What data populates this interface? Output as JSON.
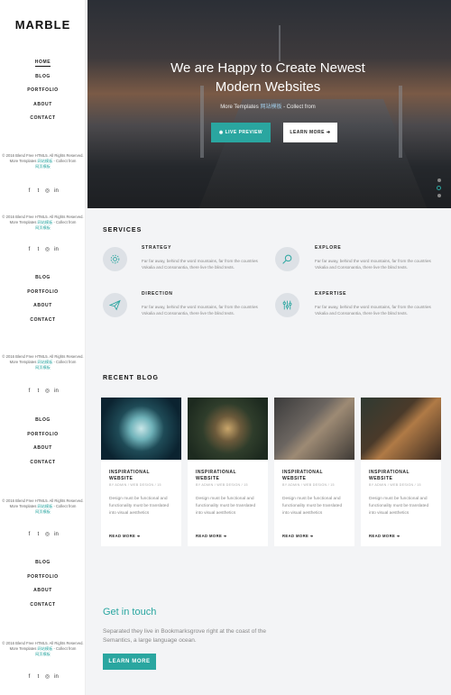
{
  "brand": {
    "logo": "MARBLE"
  },
  "nav_blocks": [
    {
      "items": [
        "HOME",
        "BLOG",
        "PORTFOLIO",
        "ABOUT",
        "CONTACT"
      ],
      "active": 0
    },
    {
      "items": [
        "BLOG",
        "PORTFOLIO",
        "ABOUT",
        "CONTACT"
      ]
    },
    {
      "items": [
        "BLOG",
        "PORTFOLIO",
        "ABOUT",
        "CONTACT"
      ]
    },
    {
      "items": [
        "BLOG",
        "PORTFOLIO",
        "ABOUT",
        "CONTACT"
      ]
    }
  ],
  "footers": [
    {
      "copyright": "© 2016 Blend Free HTML5. All Rights Reserved.",
      "more": "More Templates",
      "link": "网站模板",
      "collect": "- Collect from",
      "link2": "网页模板"
    },
    {
      "copyright": "© 2016 Blend Free HTML5. All Rights Reserved.",
      "more": "More Templates",
      "link": "网站模板",
      "collect": "- Collect from",
      "link2": "网页模板"
    },
    {
      "copyright": "© 2016 Blend Free HTML5. All Rights Reserved.",
      "more": "More Templates",
      "link": "网站模板",
      "collect": "- Collect from",
      "link2": "网页模板"
    },
    {
      "copyright": "© 2016 Blend Free HTML5. All Rights Reserved.",
      "more": "More Templates",
      "link": "网站模板",
      "collect": "- Collect from",
      "link2": "网页模板"
    },
    {
      "copyright": "© 2016 Blend Free HTML5. All Rights Reserved.",
      "more": "More Templates",
      "link": "网站模板",
      "collect": "- Collect from",
      "link2": "网页模板"
    }
  ],
  "social": {
    "facebook": "f",
    "twitter": "t",
    "instagram": "◎",
    "linkedin": "in"
  },
  "hero": {
    "title_line1": "We are Happy to Create Newest",
    "title_line2": "Modern Websites",
    "sub_prefix": "More Templates",
    "sub_link": "网站模板",
    "sub_suffix": "- Collect from",
    "btn_live": "◉ LIVE PREVIEW",
    "btn_more": "LEARN MORE ➔"
  },
  "services": {
    "title": "SERVICES",
    "items": [
      {
        "title": "STRATEGY",
        "icon": "gear-icon",
        "text": "Far far away, behind the word mountains, far from the countries Vokalia and Consonantia, there live the blind texts."
      },
      {
        "title": "EXPLORE",
        "icon": "search-icon",
        "text": "Far far away, behind the word mountains, far from the countries Vokalia and Consonantia, there live the blind texts."
      },
      {
        "title": "DIRECTION",
        "icon": "paper-plane-icon",
        "text": "Far far away, behind the word mountains, far from the countries Vokalia and Consonantia, there live the blind texts."
      },
      {
        "title": "EXPERTISE",
        "icon": "sliders-icon",
        "text": "Far far away, behind the word mountains, far from the countries Vokalia and Consonantia, there live the blind texts."
      }
    ]
  },
  "blog": {
    "title": "RECENT BLOG",
    "posts": [
      {
        "title_line1": "INSPIRATIONAL",
        "title_line2": "WEBSITE",
        "meta": "BY ADMIN / WEB DESIGN / 15",
        "desc": "Design must be functional and functionality must be translated into visual aesthetics",
        "more": "READ MORE ➔"
      },
      {
        "title_line1": "INSPIRATIONAL",
        "title_line2": "WEBSITE",
        "meta": "BY ADMIN / WEB DESIGN / 15",
        "desc": "Design must be functional and functionality must be translated into visual aesthetics",
        "more": "READ MORE ➔"
      },
      {
        "title_line1": "INSPIRATIONAL",
        "title_line2": "WEBSITE",
        "meta": "BY ADMIN / WEB DESIGN / 15",
        "desc": "Design must be functional and functionality must be translated into visual aesthetics",
        "more": "READ MORE ➔"
      },
      {
        "title_line1": "INSPIRATIONAL",
        "title_line2": "WEBSITE",
        "meta": "BY ADMIN / WEB DESIGN / 15",
        "desc": "Design must be functional and functionality must be translated into visual aesthetics",
        "more": "READ MORE ➔"
      }
    ]
  },
  "contact": {
    "title": "Get in touch",
    "text": "Separated they live in Bookmarksgrove right at the coast of the Semantics, a large language ocean.",
    "button": "LEARN MORE"
  },
  "colors": {
    "accent": "#2aa6a0"
  }
}
